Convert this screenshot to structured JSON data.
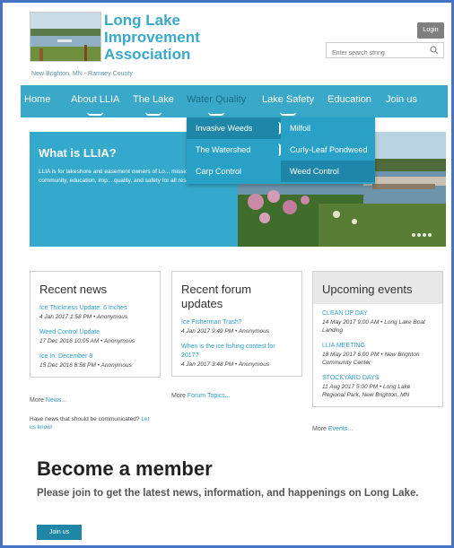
{
  "header": {
    "title_line1": "Long Lake",
    "title_line2": "Improvement",
    "title_line3": "Association",
    "subtitle": "New Brighton, MN - Ramsey County",
    "login_label": "Login",
    "search_placeholder": "Enter search string"
  },
  "nav": {
    "items": [
      {
        "label": "Home"
      },
      {
        "label": "About LLIA"
      },
      {
        "label": "The Lake"
      },
      {
        "label": "Water Quality"
      },
      {
        "label": "Lake Safety"
      },
      {
        "label": "Education"
      },
      {
        "label": "Join us"
      }
    ]
  },
  "dropdown": {
    "left": [
      "Invasive Weeds",
      "The Watershed",
      "Carp Control"
    ],
    "right": [
      "Milfoil",
      "Curly-Leaf Pondweed",
      "Weed Control"
    ]
  },
  "hero": {
    "title": "What is LLIA?",
    "text": "LLIA is for lakeshore and easement owners of Lo... mission is to provide community, education, imp... quality, and safety for all residents."
  },
  "news": {
    "heading": "Recent news",
    "entries": [
      {
        "title": "Ice Thickness Update: 6 Inches",
        "meta": "4 Jan 2017 1:58 PM • Anonymous"
      },
      {
        "title": "Weed Control Update",
        "meta": "17 Dec 2016 10:05 AM • Anonymous"
      },
      {
        "title": "Ice In: December 8",
        "meta": "15 Dec 2016 8:56 PM • Anonymous"
      }
    ],
    "more_prefix": "More",
    "more_link": "News...",
    "ask_text": "Have news that should be communicated?",
    "ask_link": "Let us know!"
  },
  "forum": {
    "heading": "Recent forum updates",
    "entries": [
      {
        "title": "Ice Fisherman Trash?",
        "meta": "4 Jan 2017 9:49 PM • Anonymous"
      },
      {
        "title": "When is the ice fishing contest for 2017?",
        "meta": "4 Jan 2017 3:48 PM • Anonymous"
      }
    ],
    "more_prefix": "More",
    "more_link": "Forum Topics..."
  },
  "events": {
    "heading": "Upcoming events",
    "entries": [
      {
        "title": "CLEAN UP DAY",
        "meta": "14 May 2017 9:00 AM • Long Lake Boat Landing"
      },
      {
        "title": "LLIA MEETING",
        "meta": "18 May 2017 6:00 PM • New Brighton Community Center"
      },
      {
        "title": "STOCKYARD DAYS",
        "meta": "11 Aug 2017 5:00 PM • Long Lake Regional Park, New Brighton, MN"
      }
    ],
    "more_prefix": "More",
    "more_link": "Events..."
  },
  "member": {
    "title": "Become a member",
    "text": "Please join to get the latest news, information, and happenings on Long Lake.",
    "button": "Join us"
  },
  "colors": {
    "brand": "#39a8c9",
    "frame": "#4472c4",
    "button_dark": "#1f86a5"
  }
}
